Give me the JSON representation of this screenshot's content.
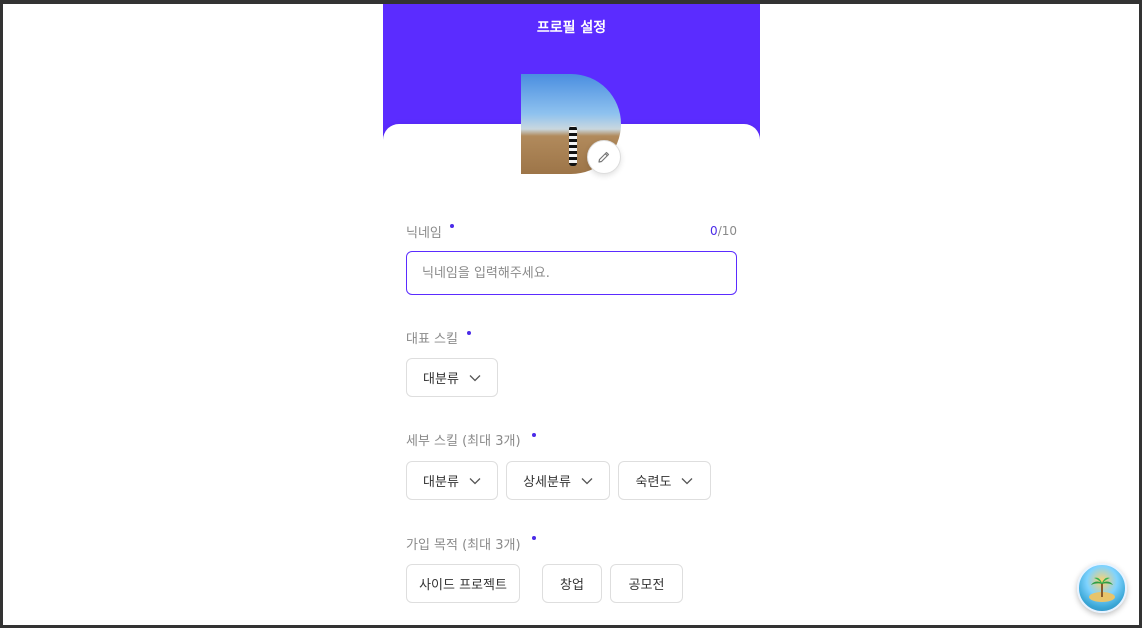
{
  "header": {
    "title": "프로필 설정"
  },
  "profile": {
    "avatar_alt": "profile-photo",
    "edit_icon": "pencil-icon"
  },
  "nickname": {
    "label": "닉네임",
    "counter_current": "0",
    "counter_max": "/10",
    "placeholder": "닉네임을 입력해주세요."
  },
  "main_skill": {
    "label": "대표 스킬",
    "dropdowns": [
      {
        "label": "대분류"
      }
    ]
  },
  "detail_skill": {
    "label": "세부 스킬 (최대 3개)",
    "dropdowns": [
      {
        "label": "대분류"
      },
      {
        "label": "상세분류"
      },
      {
        "label": "숙련도"
      }
    ]
  },
  "purpose": {
    "label": "가입 목적 (최대 3개)",
    "options": [
      {
        "label": "사이드 프로젝트"
      },
      {
        "label": "창업"
      },
      {
        "label": "공모전"
      }
    ]
  },
  "colors": {
    "brand": "#5b2cff",
    "required_dot": "#4b2be8"
  }
}
